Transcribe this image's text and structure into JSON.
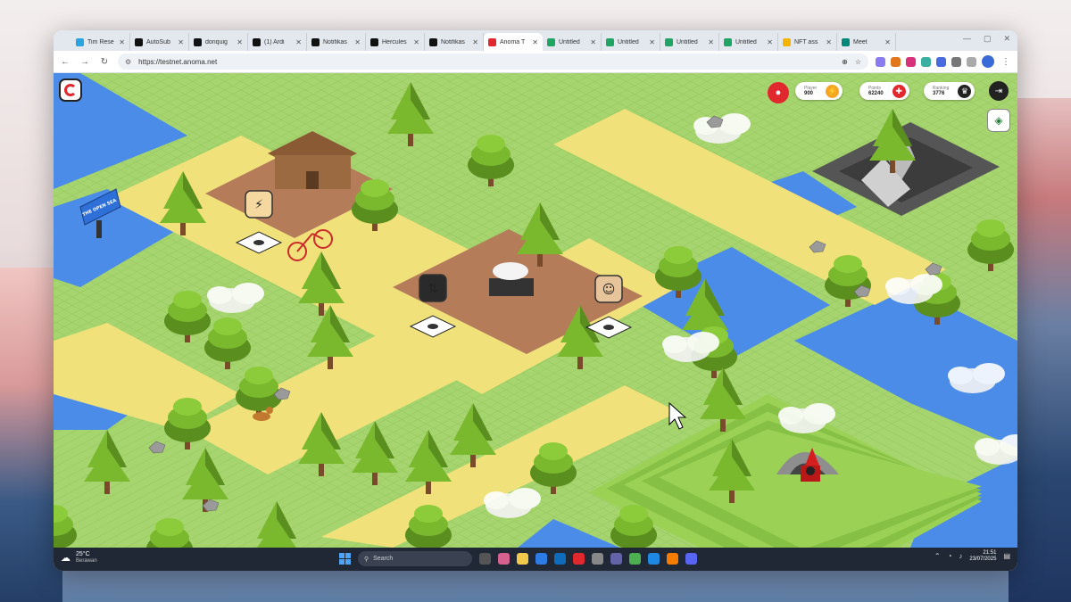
{
  "browser": {
    "tabs": [
      {
        "title": "Tim Rese",
        "icon": "telegram-icon",
        "color": "#2aa3e0"
      },
      {
        "title": "AutoSub",
        "icon": "x-icon",
        "color": "#111111"
      },
      {
        "title": "donquig",
        "icon": "x-icon",
        "color": "#111111"
      },
      {
        "title": "(1) Ardi",
        "icon": "x-icon",
        "color": "#111111"
      },
      {
        "title": "Notifikas",
        "icon": "x-icon",
        "color": "#111111"
      },
      {
        "title": "Hercules",
        "icon": "x-icon",
        "color": "#111111"
      },
      {
        "title": "Notifikas",
        "icon": "x-icon",
        "color": "#111111"
      },
      {
        "title": "Anoma T",
        "icon": "anoma-icon",
        "color": "#e0282e",
        "active": true
      },
      {
        "title": "Untitled",
        "icon": "sheets-icon",
        "color": "#1fa463"
      },
      {
        "title": "Untitled",
        "icon": "sheets-icon",
        "color": "#1fa463"
      },
      {
        "title": "Untitled",
        "icon": "sheets-icon",
        "color": "#1fa463"
      },
      {
        "title": "Untitled",
        "icon": "sheets-icon",
        "color": "#1fa463"
      },
      {
        "title": "NFT ass",
        "icon": "drive-icon",
        "color": "#f4b400"
      },
      {
        "title": "Meet",
        "icon": "meet-icon",
        "color": "#00897b"
      }
    ],
    "url": "https://testnet.anoma.net"
  },
  "game": {
    "signpost_text": "THE OPEN SEA",
    "hud": {
      "player_label": "Player",
      "player_value": "900",
      "points_label": "Points",
      "points_value": "62240",
      "ranking_label": "Ranking",
      "ranking_value": "3776"
    },
    "colors": {
      "grass": "#a6d46e",
      "grass_tile": "#b9df80",
      "path": "#f1e17a",
      "water": "#4a8ce8",
      "dirt": "#b57c5a",
      "tree": "#7ab82e",
      "tree_dark": "#5a8e1e",
      "trunk": "#7a4b2a",
      "accent": "#e0282e"
    }
  },
  "taskbar": {
    "temperature": "25°C",
    "condition": "Berawan",
    "search_placeholder": "Search",
    "time": "21:51",
    "date": "23/07/2025"
  }
}
